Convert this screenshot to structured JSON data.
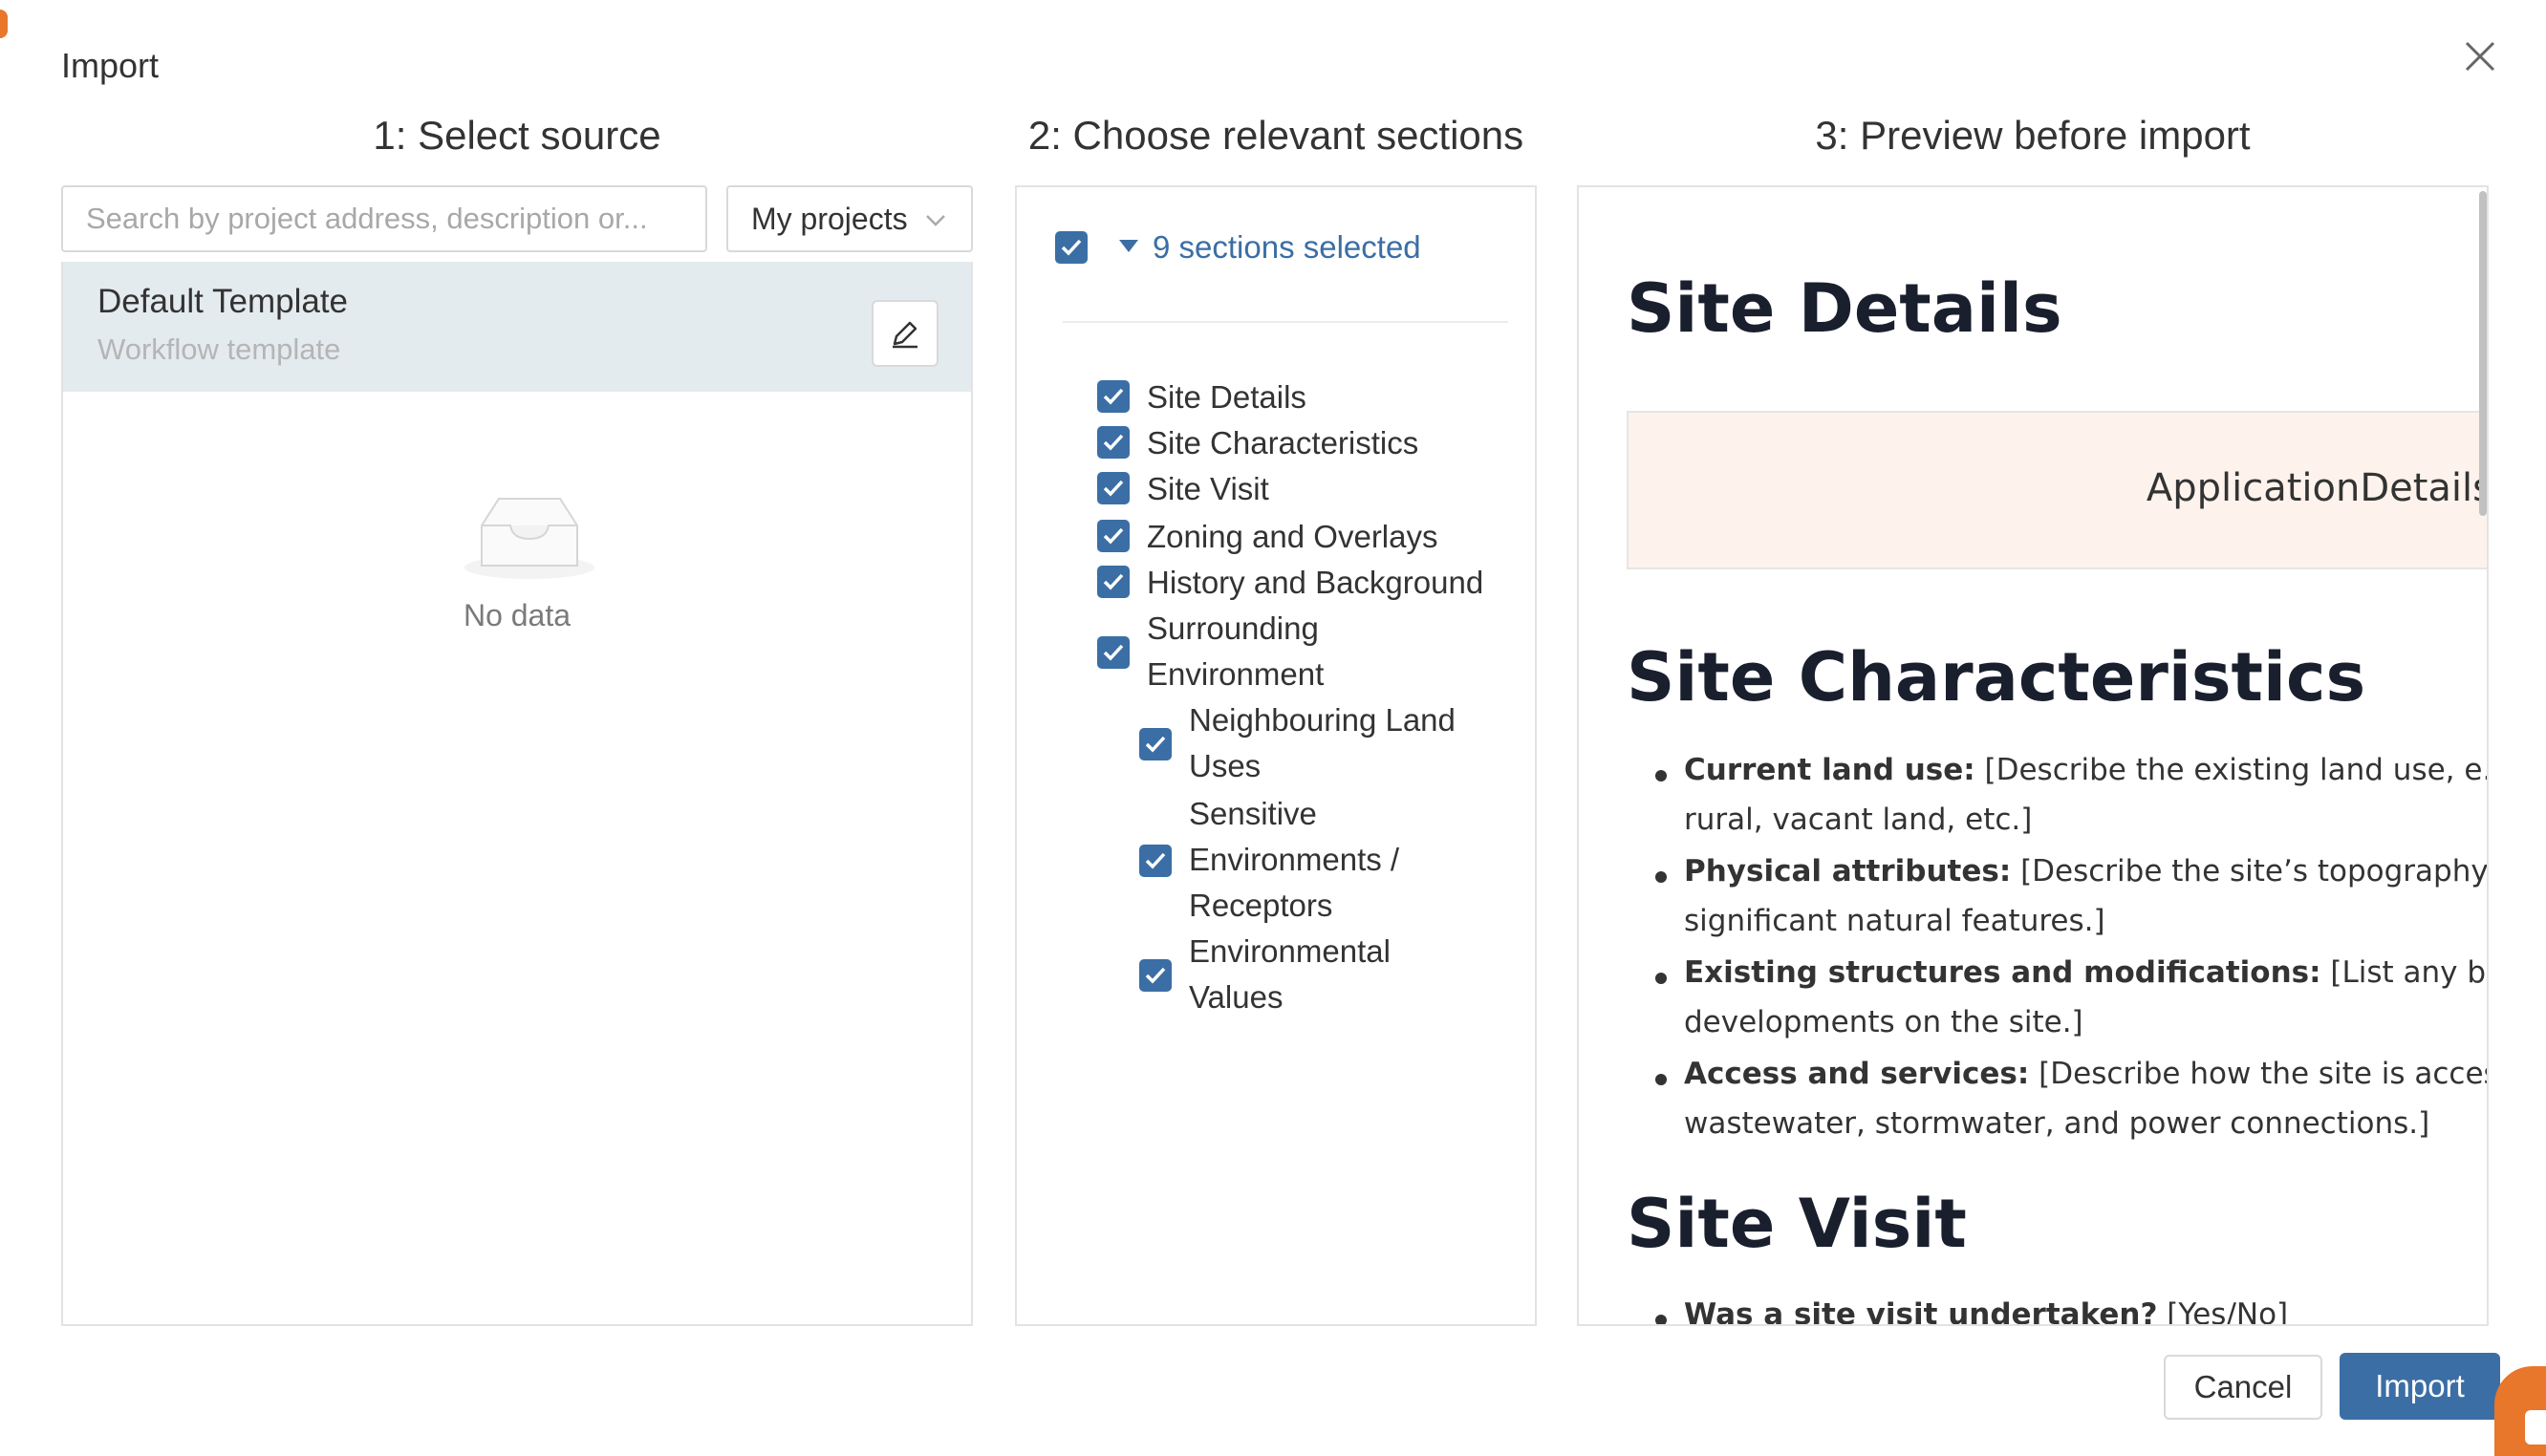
{
  "modal": {
    "title": "Import",
    "close_icon": "close-icon"
  },
  "columns": {
    "source_heading": "1: Select source",
    "sections_heading": "2: Choose relevant sections",
    "preview_heading": "3: Preview before import"
  },
  "source": {
    "search_placeholder": "Search by project address, description or...",
    "filter_value": "My projects",
    "items": [
      {
        "name": "Default Template",
        "subtitle": "Workflow template"
      }
    ],
    "empty_text": "No data"
  },
  "sections": {
    "summary": "9 sections selected",
    "items": [
      {
        "label": "Site Details",
        "checked": true,
        "level": 0
      },
      {
        "label": "Site Characteristics",
        "checked": true,
        "level": 0
      },
      {
        "label": "Site Visit",
        "checked": true,
        "level": 0
      },
      {
        "label": "Zoning and Overlays",
        "checked": true,
        "level": 0
      },
      {
        "label": "History and Background",
        "checked": true,
        "level": 0
      },
      {
        "label": "Surrounding Environment",
        "checked": true,
        "level": 0
      },
      {
        "label": "Neighbouring Land Uses",
        "checked": true,
        "level": 1
      },
      {
        "label": "Sensitive Environments / Receptors",
        "checked": true,
        "level": 1
      },
      {
        "label": "Environmental Values",
        "checked": true,
        "level": 1
      }
    ]
  },
  "preview": {
    "h1_site_details": "Site Details",
    "application_details": "ApplicationDetails",
    "h1_site_characteristics": "Site Characteristics",
    "bullets": [
      {
        "label": "Current land use:",
        "text": " [Describe the existing land use, e.g., residential,",
        "cont": "rural, vacant land, etc.]"
      },
      {
        "label": "Physical attributes:",
        "text": " [Describe the site’s topography, vegetation, and",
        "cont": "significant natural features.]"
      },
      {
        "label": "Existing structures and modifications:",
        "text": " [List any buildings or",
        "cont": "developments on the site.]"
      },
      {
        "label": "Access and services:",
        "text": " [Describe how the site is accessed and",
        "cont": "wastewater, stormwater, and power connections.]"
      }
    ],
    "h1_site_visit": "Site Visit",
    "visit_bullet_label": "Was a site visit undertaken?",
    "visit_bullet_text": " [Yes/No]"
  },
  "footer": {
    "cancel_label": "Cancel",
    "import_label": "Import"
  },
  "colors": {
    "primary": "#3b6ea5",
    "selected_row": "#e4ebef",
    "preview_box": "#fdf3ec",
    "accent": "#e8762b"
  }
}
